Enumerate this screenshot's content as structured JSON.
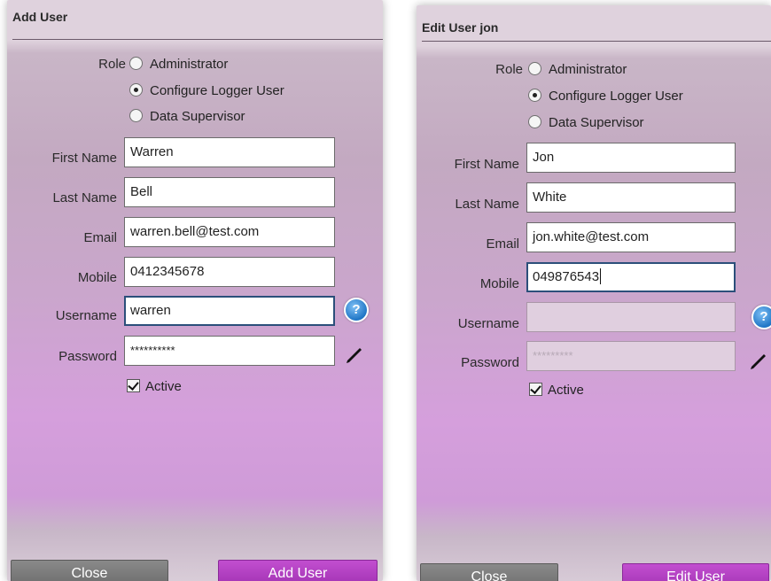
{
  "add_form": {
    "title": "Add User",
    "role_label": "Role",
    "roles": [
      {
        "label": "Administrator",
        "selected": false
      },
      {
        "label": "Configure Logger User",
        "selected": true
      },
      {
        "label": "Data Supervisor",
        "selected": false
      }
    ],
    "first_name_label": "First Name",
    "first_name_value": "Warren",
    "last_name_label": "Last Name",
    "last_name_value": "Bell",
    "email_label": "Email",
    "email_value": "warren.bell@test.com",
    "mobile_label": "Mobile",
    "mobile_value": "0412345678",
    "username_label": "Username",
    "username_value": "warren",
    "password_label": "Password",
    "password_value": "**********",
    "active_label": "Active",
    "help_glyph": "?",
    "close_label": "Close",
    "submit_label": "Add User"
  },
  "edit_form": {
    "title": "Edit User jon",
    "role_label": "Role",
    "roles": [
      {
        "label": "Administrator",
        "selected": false
      },
      {
        "label": "Configure Logger User",
        "selected": true
      },
      {
        "label": "Data Supervisor",
        "selected": false
      }
    ],
    "first_name_label": "First Name",
    "first_name_value": "Jon",
    "last_name_label": "Last Name",
    "last_name_value": "White",
    "email_label": "Email",
    "email_value": "jon.white@test.com",
    "mobile_label": "Mobile",
    "mobile_value": "049876543",
    "username_label": "Username",
    "username_value": "",
    "password_label": "Password",
    "password_value": "*********",
    "active_label": "Active",
    "help_glyph": "?",
    "close_label": "Close",
    "submit_label": "Edit User"
  },
  "icons": {
    "help": "help-icon",
    "edit_password": "pencil-icon",
    "checkbox": "checkbox-checked-icon"
  },
  "colors": {
    "primary_button": "#a232b3",
    "close_button": "#7a7a7a",
    "help_icon": "#2076c6"
  }
}
